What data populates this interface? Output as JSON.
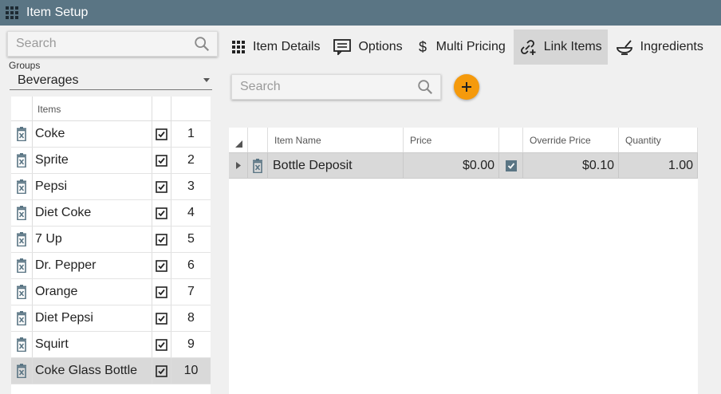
{
  "window": {
    "title": "Item Setup"
  },
  "left_panel": {
    "search_placeholder": "Search",
    "groups_label": "Groups",
    "groups_value": "Beverages",
    "items_header": "Items",
    "items": [
      {
        "name": "Coke",
        "checked": true,
        "order": "1"
      },
      {
        "name": "Sprite",
        "checked": true,
        "order": "2"
      },
      {
        "name": "Pepsi",
        "checked": true,
        "order": "3"
      },
      {
        "name": "Diet Coke",
        "checked": true,
        "order": "4"
      },
      {
        "name": "7 Up",
        "checked": true,
        "order": "5"
      },
      {
        "name": "Dr. Pepper",
        "checked": true,
        "order": "6"
      },
      {
        "name": "Orange",
        "checked": true,
        "order": "7"
      },
      {
        "name": "Diet Pepsi",
        "checked": true,
        "order": "8"
      },
      {
        "name": "Squirt",
        "checked": true,
        "order": "9"
      },
      {
        "name": "Coke Glass Bottle",
        "checked": true,
        "order": "10"
      }
    ],
    "selected_index": 9
  },
  "tabs": [
    {
      "label": "Item Details",
      "icon": "grid-icon"
    },
    {
      "label": "Options",
      "icon": "comment-icon"
    },
    {
      "label": "Multi Pricing",
      "icon": "dollar-icon"
    },
    {
      "label": "Link Items",
      "icon": "link-add-icon",
      "active": true
    },
    {
      "label": "Ingredients",
      "icon": "bowl-icon"
    }
  ],
  "link_panel": {
    "search_placeholder": "Search",
    "columns": {
      "item_name": "Item Name",
      "price": "Price",
      "override_price": "Override Price",
      "quantity": "Quantity"
    },
    "rows": [
      {
        "item_name": "Bottle Deposit",
        "price": "$0.00",
        "override": true,
        "override_price": "$0.10",
        "quantity": "1.00"
      }
    ]
  },
  "colors": {
    "titlebar": "#5a7584",
    "accent": "#f59a0c",
    "checkbox_active": "#5a7584"
  }
}
